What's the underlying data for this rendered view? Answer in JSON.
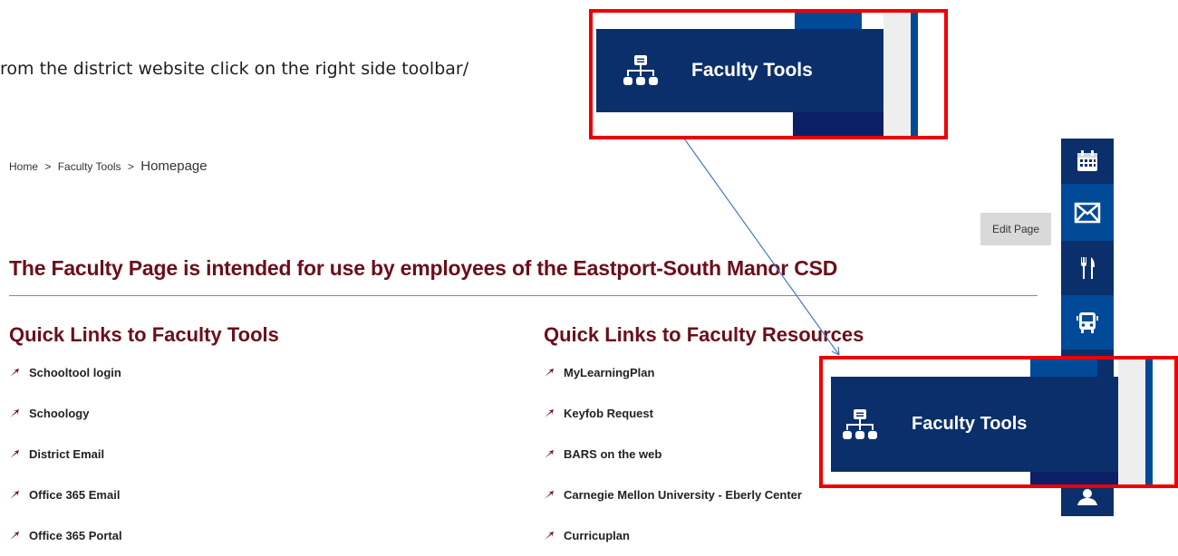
{
  "instruction": "rom the district website click on the right side toolbar/",
  "breadcrumb": {
    "home": "Home",
    "sep1": ">",
    "section": "Faculty Tools",
    "sep2": ">",
    "current": "Homepage"
  },
  "headline": "The Faculty Page is intended for use by employees of the Eastport-South Manor CSD",
  "tools": {
    "heading": "Quick Links to Faculty Tools",
    "links": [
      "Schooltool login",
      "Schoology",
      "District Email",
      "Office 365 Email",
      "Office 365 Portal"
    ]
  },
  "resources": {
    "heading": "Quick Links to Faculty Resources",
    "links": [
      "MyLearningPlan",
      "Keyfob Request",
      "BARS on the web",
      "Carnegie Mellon University - Eberly Center",
      "Curricuplan"
    ]
  },
  "edit_page": "Edit Page",
  "callout_top": {
    "label": "Faculty Tools",
    "icon": "org-chart-icon"
  },
  "callout_bottom": {
    "label": "Faculty Tools",
    "icon": "org-chart-icon"
  },
  "sidebar_icons": [
    "calendar-icon",
    "mail-icon",
    "dining-icon",
    "bus-icon",
    "staff-icon"
  ],
  "colors": {
    "maroon": "#6b0f1a",
    "navy": "#0b2f6b",
    "highlight": "#ee0000"
  }
}
